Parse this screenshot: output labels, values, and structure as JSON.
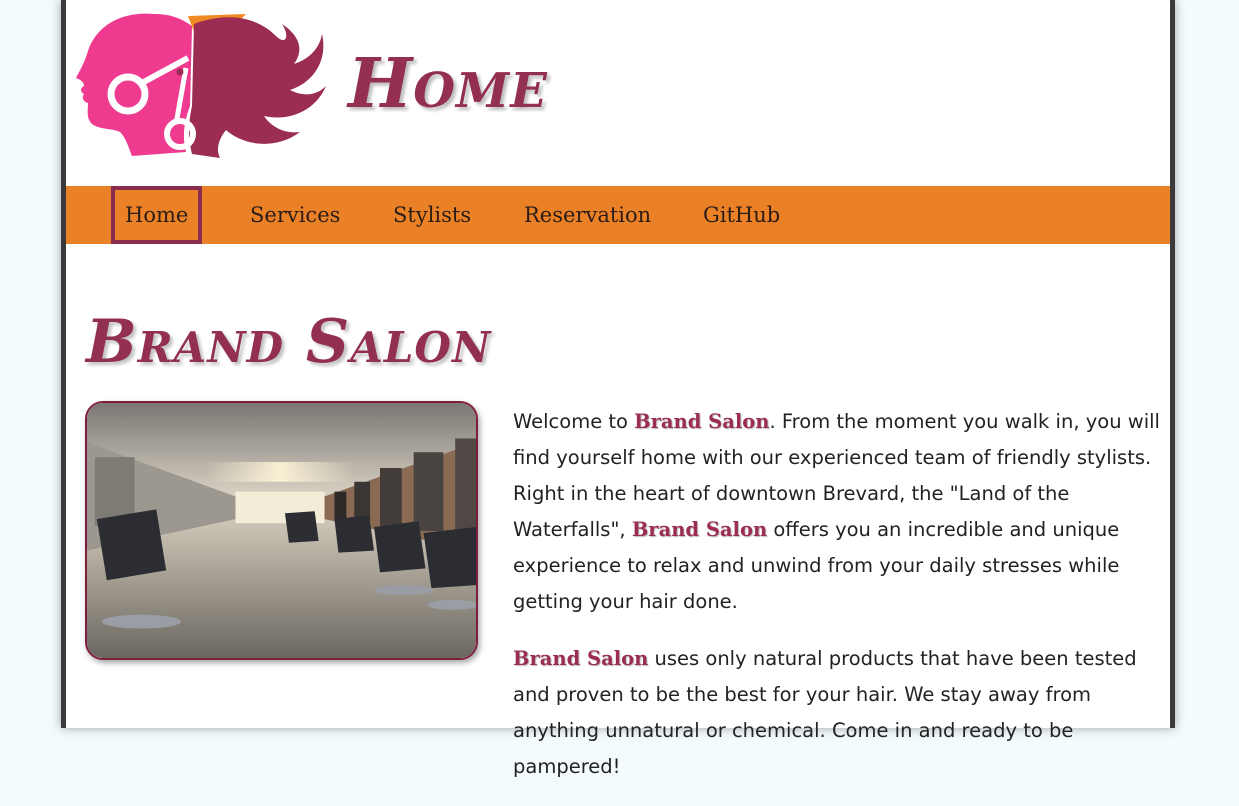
{
  "header": {
    "title": "Home"
  },
  "nav": {
    "items": [
      {
        "label": "Home",
        "active": true
      },
      {
        "label": "Services"
      },
      {
        "label": "Stylists"
      },
      {
        "label": "Reservation"
      },
      {
        "label": "GitHub"
      }
    ]
  },
  "main": {
    "title": "Brand Salon",
    "paragraph1": {
      "p1": "Welcome to ",
      "brand1": "Brand Salon",
      "p2": ". From the moment you walk in, you will find yourself home with our experienced team of friendly stylists. Right in the heart of downtown Brevard, the \"Land of the Waterfalls\", ",
      "brand2": "Brand Salon",
      "p3": " offers you an incredible and unique experience to relax and unwind from your daily stresses while getting your hair done."
    },
    "paragraph2": {
      "brand": "Brand Salon",
      "text": " uses only natural products that have been tested and proven to be the best for your hair. We stay away from anything unnatural or chemical. Come in and ready to be pampered!"
    }
  },
  "colors": {
    "accent": "#93304f",
    "nav_bg": "#eb8126",
    "logo_pink": "#ee3a8f",
    "logo_orange": "#f08a24"
  }
}
